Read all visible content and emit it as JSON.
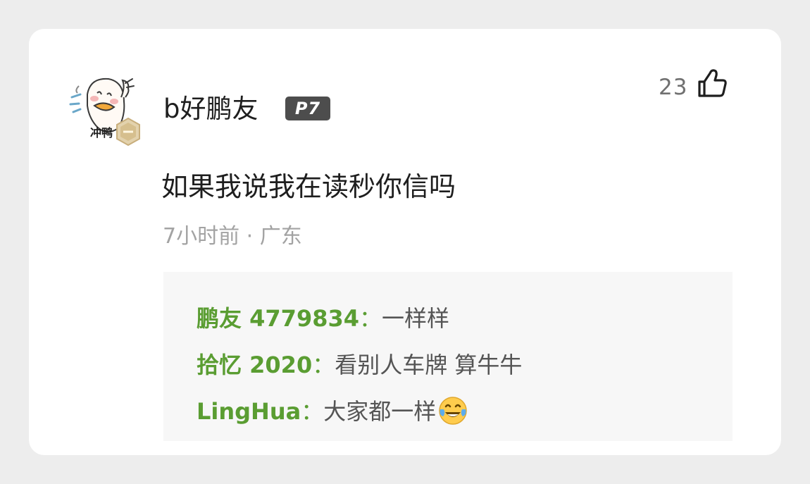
{
  "comment": {
    "username": "b好鹏友",
    "level_badge": "P7",
    "avatar_text": "冲鸭",
    "like_count": "23",
    "text": "如果我说我在读秒你信吗",
    "time": "7小时前",
    "separator": "·",
    "location": "广东"
  },
  "replies": [
    {
      "author": "鹏友 4779834",
      "colon": "：",
      "content": "一样样"
    },
    {
      "author": "拾忆 2020",
      "colon": "：",
      "content": "看别人车牌 算牛牛"
    },
    {
      "author": "LingHua",
      "colon": "：",
      "content": "大家都一样",
      "emoji": "tears-of-joy-emoji"
    }
  ],
  "icons": {
    "like": "thumbs-up-icon",
    "avatar": "duck-avatar-icon"
  },
  "colors": {
    "page_background": "#ededed",
    "card_background": "#ffffff",
    "replies_background": "#f7f7f7",
    "reply_author": "#5a9d32",
    "badge": "#4d4d4d",
    "secondary_text": "#a3a3a3"
  }
}
